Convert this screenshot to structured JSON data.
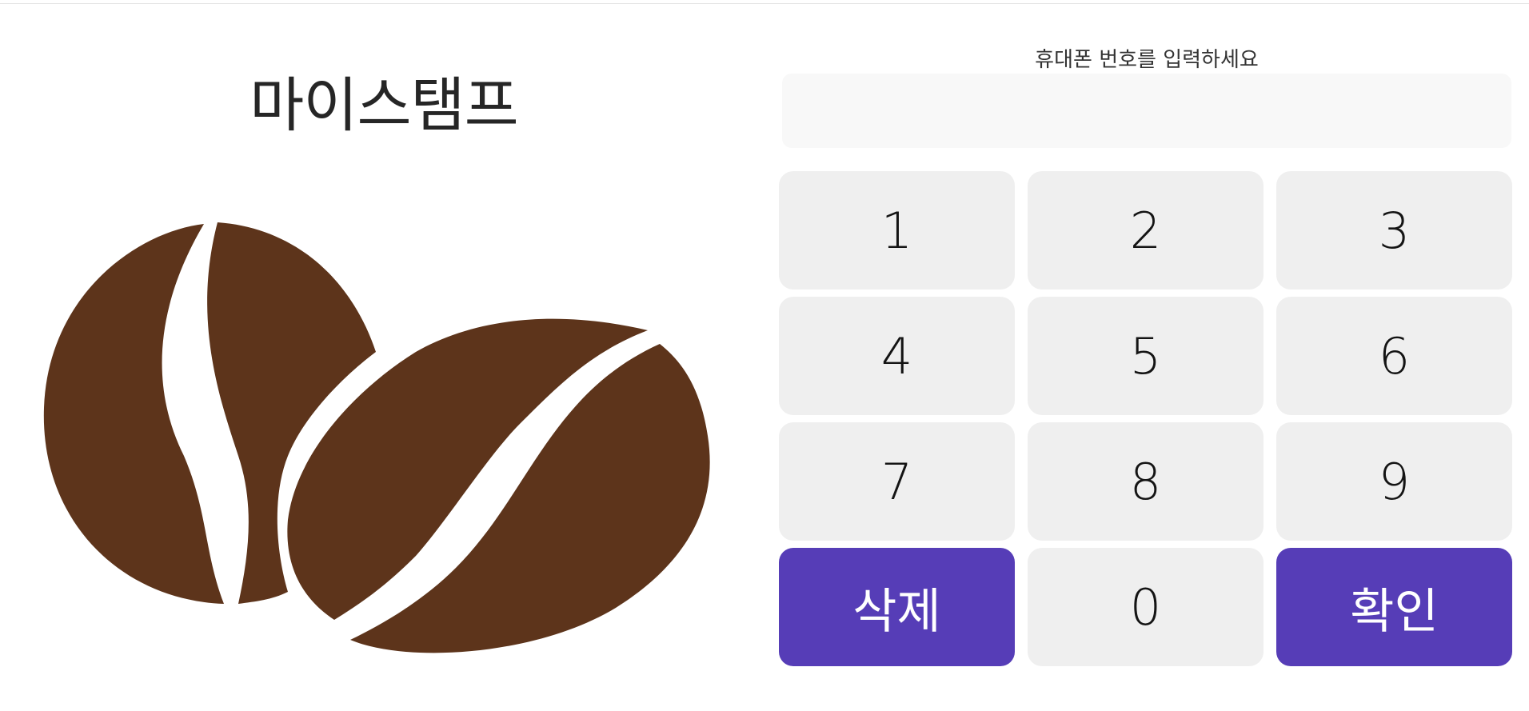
{
  "app": {
    "brand_title": "마이스탬프"
  },
  "illustration": {
    "icon": "coffee-beans-icon",
    "bean_color": "#5d341b"
  },
  "phone_entry": {
    "prompt": "휴대폰 번호를 입력하세요",
    "value": ""
  },
  "keypad": {
    "keys": [
      "1",
      "2",
      "3",
      "4",
      "5",
      "6",
      "7",
      "8",
      "9"
    ],
    "delete_label": "삭제",
    "zero_label": "0",
    "confirm_label": "확인"
  },
  "colors": {
    "accent": "#563db7",
    "key_background": "#efefef",
    "display_background": "#f8f8f8"
  }
}
